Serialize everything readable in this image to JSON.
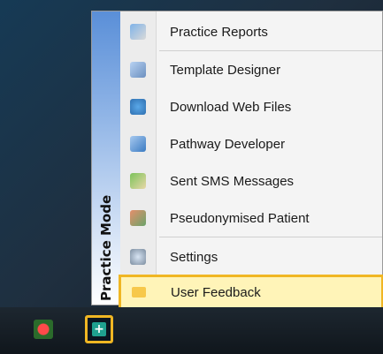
{
  "menu": {
    "side_label": "Practice Mode",
    "items": [
      {
        "label": "Practice Reports",
        "icon": "reports-icon"
      },
      {
        "label": "Template Designer",
        "icon": "template-designer-icon"
      },
      {
        "label": "Download Web Files",
        "icon": "download-web-icon"
      },
      {
        "label": "Pathway Developer",
        "icon": "pathway-icon"
      },
      {
        "label": "Sent SMS Messages",
        "icon": "sms-icon"
      },
      {
        "label": "Pseudonymised Patient",
        "icon": "patient-icon"
      },
      {
        "label": "Settings",
        "icon": "settings-icon"
      },
      {
        "label": "User Feedback",
        "icon": "feedback-icon"
      }
    ]
  },
  "taskbar": {
    "icons": [
      "red-app-icon",
      "practice-app-icon"
    ]
  }
}
